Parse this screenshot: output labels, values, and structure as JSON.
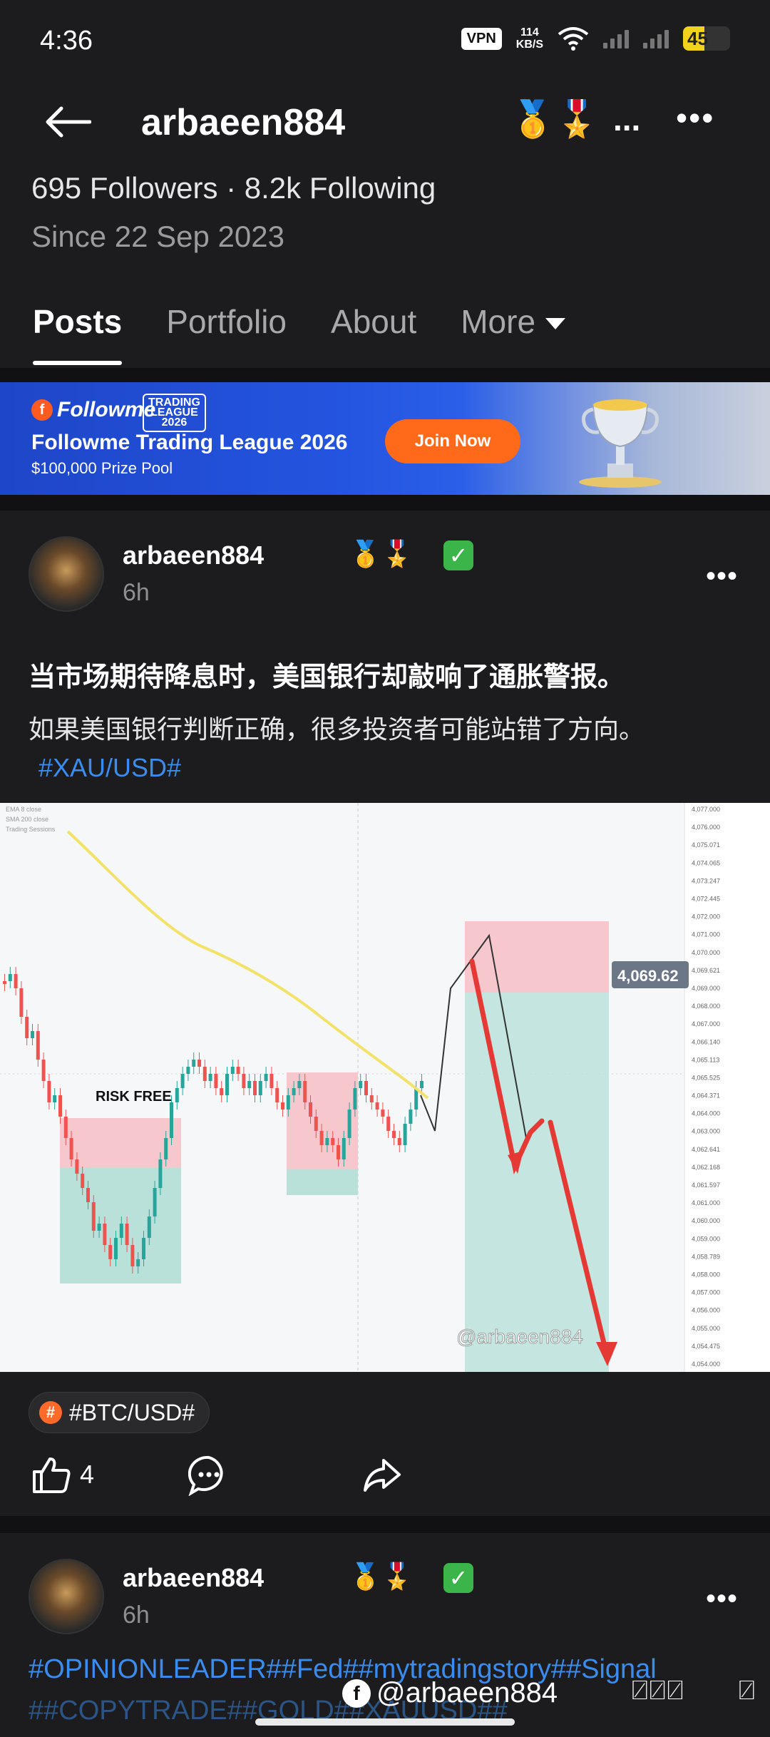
{
  "status_bar": {
    "time": "4:36",
    "vpn": "VPN",
    "speed_value": "114",
    "speed_unit": "KB/S",
    "battery": "45"
  },
  "header": {
    "username": "arbaeen884",
    "medals": "🥇🎖️",
    "medal_more": "...",
    "more": "•••"
  },
  "profile": {
    "stats": "695 Followers · 8.2k Following",
    "since": "Since 22 Sep 2023"
  },
  "tabs": [
    {
      "label": "Posts",
      "active": true
    },
    {
      "label": "Portfolio"
    },
    {
      "label": "About"
    },
    {
      "label": "More"
    }
  ],
  "banner": {
    "brand": "Followme",
    "badge_line1": "TRADING",
    "badge_line2": "LEAGUE",
    "badge_line3": "2026",
    "title": "Followme Trading League 2026",
    "subtitle": "$100,000 Prize Pool",
    "cta": "Join Now"
  },
  "post1": {
    "username": "arbaeen884",
    "medals": "🥇🎖️",
    "check": "✓",
    "time": "6h",
    "headline": "当市场期待降息时，美国银行却敲响了通胀警报。",
    "body": "如果美国银行判断正确，很多投资者可能站错了方向。",
    "hashtag": "#XAU/USD#",
    "tag": "#BTC/USD#",
    "likes": "4",
    "more": "•••"
  },
  "chart": {
    "label_risk_free": "RISK FREE",
    "price_label": "4,069.62",
    "watermark": "@arbaeen884",
    "legend_1": "EMA 8 close",
    "legend_2": "SMA 200 close",
    "legend_3": "Trading Sessions",
    "y_ticks": [
      "4,077.000",
      "4,076.000",
      "4,075.071",
      "4,074.065",
      "4,073.247",
      "4,072.445",
      "4,072.000",
      "4,071.000",
      "4,070.000",
      "4,069.621",
      "4,069.000",
      "4,068.000",
      "4,067.000",
      "4,066.140",
      "4,065.113",
      "4,065.525",
      "4,064.371",
      "4,064.000",
      "4,063.000",
      "4,062.641",
      "4,062.168",
      "4,061.597",
      "4,061.000",
      "4,060.000",
      "4,059.000",
      "4,058.789",
      "4,058.000",
      "4,057.000",
      "4,056.000",
      "4,055.000",
      "4,054.475",
      "4,054.000"
    ]
  },
  "post2": {
    "username": "arbaeen884",
    "medals": "🥇🎖️",
    "check": "✓",
    "time": "6h",
    "more": "•••",
    "hashtags": "#OPINIONLEADER##Fed##mytradingstory##Signal",
    "hashtags2": "##COPYTRADE##GOLD##XAUUSD##"
  },
  "watermark": {
    "text": "@arbaeen884",
    "boxes": "⍁⍁⍁",
    "box2": "⍁"
  },
  "colors": {
    "background": "#1c1c1e",
    "accent_blue": "#3a8cf0",
    "cta_orange": "#ff6a1a",
    "candle_up": "#26a69a",
    "candle_down": "#ef5350"
  }
}
